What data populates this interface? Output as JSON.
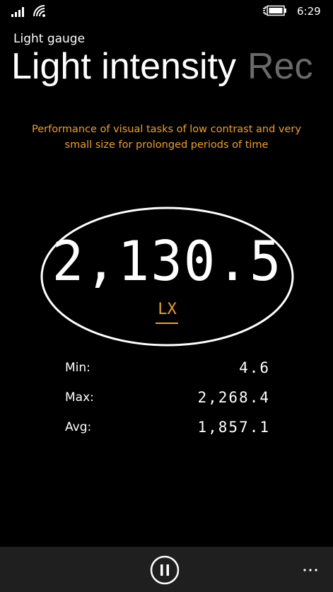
{
  "status_bar": {
    "time": "6:29",
    "icons": [
      "signal-icon",
      "wifi-icon",
      "battery-charging-icon"
    ]
  },
  "header": {
    "app_title": "Light gauge",
    "pivot_items": [
      "Light intensity",
      "Rec"
    ]
  },
  "description": "Performance of visual tasks of low contrast  and very small size for prolonged periods of time",
  "gauge": {
    "value": "2,130.5",
    "unit": "LX"
  },
  "stats": [
    {
      "label": "Min:",
      "value": "4.6"
    },
    {
      "label": "Max:",
      "value": "2,268.4"
    },
    {
      "label": "Avg:",
      "value": "1,857.1"
    }
  ],
  "app_bar": {
    "buttons": [
      "pause-icon",
      "more-icon"
    ],
    "background": "#1f1f1f"
  },
  "colors": {
    "accent": "#f0a020",
    "background": "#000000",
    "text": "#ffffff",
    "pivot_inactive": "#6a6a6a"
  }
}
